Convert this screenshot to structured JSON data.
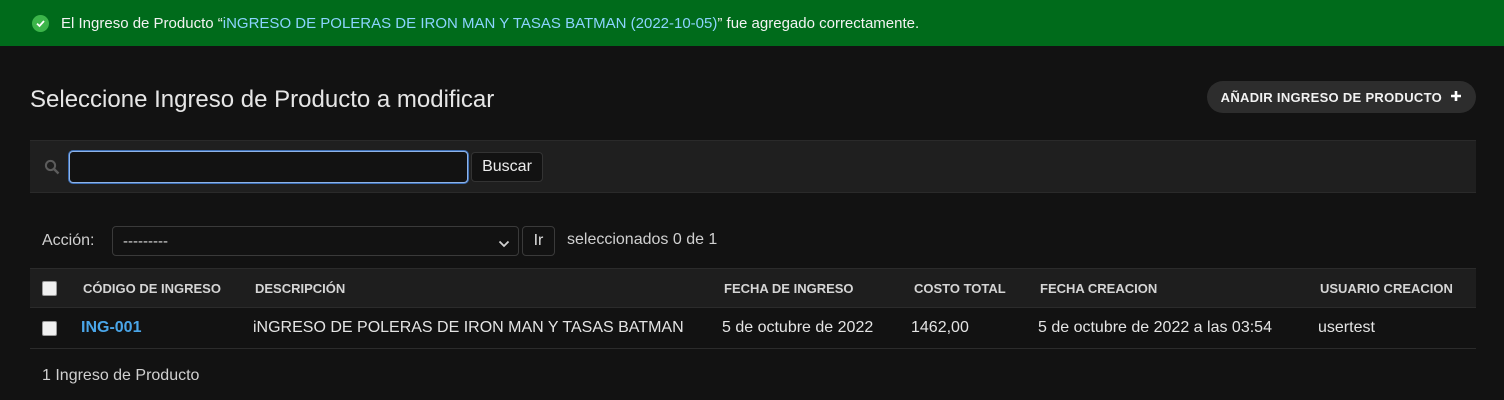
{
  "message": {
    "prefix": "El Ingreso de Producto “",
    "link": "iNGRESO DE POLERAS DE IRON MAN Y TASAS BATMAN (2022-10-05)",
    "suffix": "” fue agregado correctamente."
  },
  "page": {
    "title": "Seleccione Ingreso de Producto a modificar",
    "add_button": "AÑADIR INGRESO DE PRODUCTO"
  },
  "search": {
    "value": "",
    "placeholder": "",
    "button": "Buscar"
  },
  "actions": {
    "label": "Acción:",
    "selected_option": "---------",
    "go_button": "Ir",
    "counter": "seleccionados 0 de 1"
  },
  "table": {
    "columns": [
      "CÓDIGO DE INGRESO",
      "DESCRIPCIÓN",
      "FECHA DE INGRESO",
      "COSTO TOTAL",
      "FECHA CREACION",
      "USUARIO CREACION"
    ],
    "rows": [
      {
        "code": "ING-001",
        "description": "iNGRESO DE POLERAS DE IRON MAN Y TASAS BATMAN",
        "date": "5 de octubre de 2022",
        "cost": "1462,00",
        "created": "5 de octubre de 2022 a las 03:54",
        "user": "usertest"
      }
    ]
  },
  "footer": {
    "count": "1 Ingreso de Producto"
  },
  "colors": {
    "success_bg": "#006b1b",
    "link": "#4aa6e9",
    "background": "#121212"
  }
}
